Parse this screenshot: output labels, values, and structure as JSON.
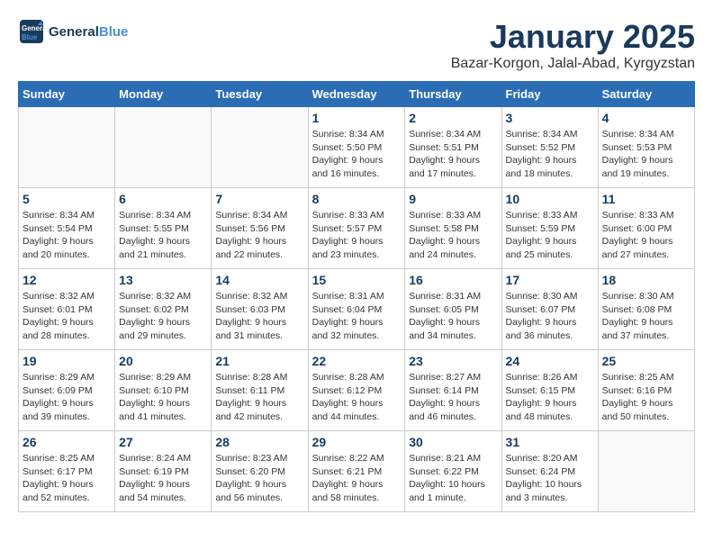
{
  "header": {
    "logo_line1": "General",
    "logo_line2": "Blue",
    "month_title": "January 2025",
    "location": "Bazar-Korgon, Jalal-Abad, Kyrgyzstan"
  },
  "days_of_week": [
    "Sunday",
    "Monday",
    "Tuesday",
    "Wednesday",
    "Thursday",
    "Friday",
    "Saturday"
  ],
  "weeks": [
    [
      {
        "day": "",
        "info": ""
      },
      {
        "day": "",
        "info": ""
      },
      {
        "day": "",
        "info": ""
      },
      {
        "day": "1",
        "info": "Sunrise: 8:34 AM\nSunset: 5:50 PM\nDaylight: 9 hours\nand 16 minutes."
      },
      {
        "day": "2",
        "info": "Sunrise: 8:34 AM\nSunset: 5:51 PM\nDaylight: 9 hours\nand 17 minutes."
      },
      {
        "day": "3",
        "info": "Sunrise: 8:34 AM\nSunset: 5:52 PM\nDaylight: 9 hours\nand 18 minutes."
      },
      {
        "day": "4",
        "info": "Sunrise: 8:34 AM\nSunset: 5:53 PM\nDaylight: 9 hours\nand 19 minutes."
      }
    ],
    [
      {
        "day": "5",
        "info": "Sunrise: 8:34 AM\nSunset: 5:54 PM\nDaylight: 9 hours\nand 20 minutes."
      },
      {
        "day": "6",
        "info": "Sunrise: 8:34 AM\nSunset: 5:55 PM\nDaylight: 9 hours\nand 21 minutes."
      },
      {
        "day": "7",
        "info": "Sunrise: 8:34 AM\nSunset: 5:56 PM\nDaylight: 9 hours\nand 22 minutes."
      },
      {
        "day": "8",
        "info": "Sunrise: 8:33 AM\nSunset: 5:57 PM\nDaylight: 9 hours\nand 23 minutes."
      },
      {
        "day": "9",
        "info": "Sunrise: 8:33 AM\nSunset: 5:58 PM\nDaylight: 9 hours\nand 24 minutes."
      },
      {
        "day": "10",
        "info": "Sunrise: 8:33 AM\nSunset: 5:59 PM\nDaylight: 9 hours\nand 25 minutes."
      },
      {
        "day": "11",
        "info": "Sunrise: 8:33 AM\nSunset: 6:00 PM\nDaylight: 9 hours\nand 27 minutes."
      }
    ],
    [
      {
        "day": "12",
        "info": "Sunrise: 8:32 AM\nSunset: 6:01 PM\nDaylight: 9 hours\nand 28 minutes."
      },
      {
        "day": "13",
        "info": "Sunrise: 8:32 AM\nSunset: 6:02 PM\nDaylight: 9 hours\nand 29 minutes."
      },
      {
        "day": "14",
        "info": "Sunrise: 8:32 AM\nSunset: 6:03 PM\nDaylight: 9 hours\nand 31 minutes."
      },
      {
        "day": "15",
        "info": "Sunrise: 8:31 AM\nSunset: 6:04 PM\nDaylight: 9 hours\nand 32 minutes."
      },
      {
        "day": "16",
        "info": "Sunrise: 8:31 AM\nSunset: 6:05 PM\nDaylight: 9 hours\nand 34 minutes."
      },
      {
        "day": "17",
        "info": "Sunrise: 8:30 AM\nSunset: 6:07 PM\nDaylight: 9 hours\nand 36 minutes."
      },
      {
        "day": "18",
        "info": "Sunrise: 8:30 AM\nSunset: 6:08 PM\nDaylight: 9 hours\nand 37 minutes."
      }
    ],
    [
      {
        "day": "19",
        "info": "Sunrise: 8:29 AM\nSunset: 6:09 PM\nDaylight: 9 hours\nand 39 minutes."
      },
      {
        "day": "20",
        "info": "Sunrise: 8:29 AM\nSunset: 6:10 PM\nDaylight: 9 hours\nand 41 minutes."
      },
      {
        "day": "21",
        "info": "Sunrise: 8:28 AM\nSunset: 6:11 PM\nDaylight: 9 hours\nand 42 minutes."
      },
      {
        "day": "22",
        "info": "Sunrise: 8:28 AM\nSunset: 6:12 PM\nDaylight: 9 hours\nand 44 minutes."
      },
      {
        "day": "23",
        "info": "Sunrise: 8:27 AM\nSunset: 6:14 PM\nDaylight: 9 hours\nand 46 minutes."
      },
      {
        "day": "24",
        "info": "Sunrise: 8:26 AM\nSunset: 6:15 PM\nDaylight: 9 hours\nand 48 minutes."
      },
      {
        "day": "25",
        "info": "Sunrise: 8:25 AM\nSunset: 6:16 PM\nDaylight: 9 hours\nand 50 minutes."
      }
    ],
    [
      {
        "day": "26",
        "info": "Sunrise: 8:25 AM\nSunset: 6:17 PM\nDaylight: 9 hours\nand 52 minutes."
      },
      {
        "day": "27",
        "info": "Sunrise: 8:24 AM\nSunset: 6:19 PM\nDaylight: 9 hours\nand 54 minutes."
      },
      {
        "day": "28",
        "info": "Sunrise: 8:23 AM\nSunset: 6:20 PM\nDaylight: 9 hours\nand 56 minutes."
      },
      {
        "day": "29",
        "info": "Sunrise: 8:22 AM\nSunset: 6:21 PM\nDaylight: 9 hours\nand 58 minutes."
      },
      {
        "day": "30",
        "info": "Sunrise: 8:21 AM\nSunset: 6:22 PM\nDaylight: 10 hours\nand 1 minute."
      },
      {
        "day": "31",
        "info": "Sunrise: 8:20 AM\nSunset: 6:24 PM\nDaylight: 10 hours\nand 3 minutes."
      },
      {
        "day": "",
        "info": ""
      }
    ]
  ]
}
